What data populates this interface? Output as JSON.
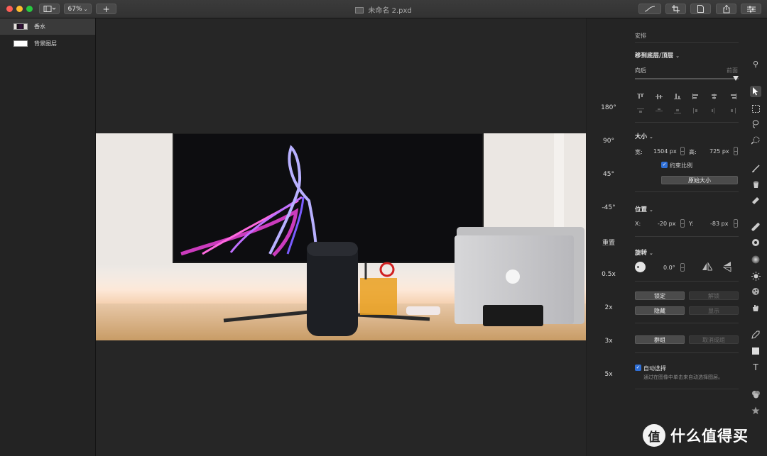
{
  "window": {
    "title": "未命名 2.pxd",
    "zoom": "67%",
    "add_label": "+",
    "traffic_colors": [
      "#fe5f57",
      "#febc2e",
      "#28c840"
    ]
  },
  "layers": [
    {
      "name": "香水",
      "selected": true
    },
    {
      "name": "背景图层",
      "selected": false
    }
  ],
  "zoom_presets": [
    "180°",
    "90°",
    "45°",
    "-45°",
    "重置",
    "0.5x",
    "2x",
    "3x",
    "5x"
  ],
  "arrange": {
    "title": "安排",
    "order_label": "移到底层/顶层",
    "back_label": "向后",
    "front_label": "前面"
  },
  "size": {
    "title": "大小",
    "width_label": "宽:",
    "width_value": "1504 px",
    "height_label": "高:",
    "height_value": "725 px",
    "constrain_label": "约束比例",
    "constrain_checked": true,
    "original_size_label": "原始大小"
  },
  "position": {
    "title": "位置",
    "x_label": "X:",
    "x_value": "-20 px",
    "y_label": "Y:",
    "y_value": "-83 px"
  },
  "rotate": {
    "title": "旋转",
    "angle": "0.0°"
  },
  "lock": {
    "lock_label": "锁定",
    "unlock_label": "解锁"
  },
  "visibility": {
    "hide_label": "隐藏",
    "show_label": "显示"
  },
  "group": {
    "group_label": "群组",
    "ungroup_label": "取消成组"
  },
  "auto_select": {
    "label": "自动选择",
    "checked": true,
    "hint": "通过在图像中单击来自动选择图层。"
  },
  "watermark": {
    "text": "什么值得买",
    "badge": "值"
  },
  "tools": [
    "wand-tool",
    "pointer-tool",
    "marquee-tool",
    "lasso-tool",
    "quick-select-tool",
    "brush-tool",
    "bucket-tool",
    "eraser-tool",
    "bandage-tool",
    "clone-tool",
    "blur-tool",
    "sun-tool",
    "sponge-tool",
    "smudge-tool",
    "pen-tool",
    "shape-tool",
    "text-tool",
    "color-tool",
    "star-tool"
  ]
}
